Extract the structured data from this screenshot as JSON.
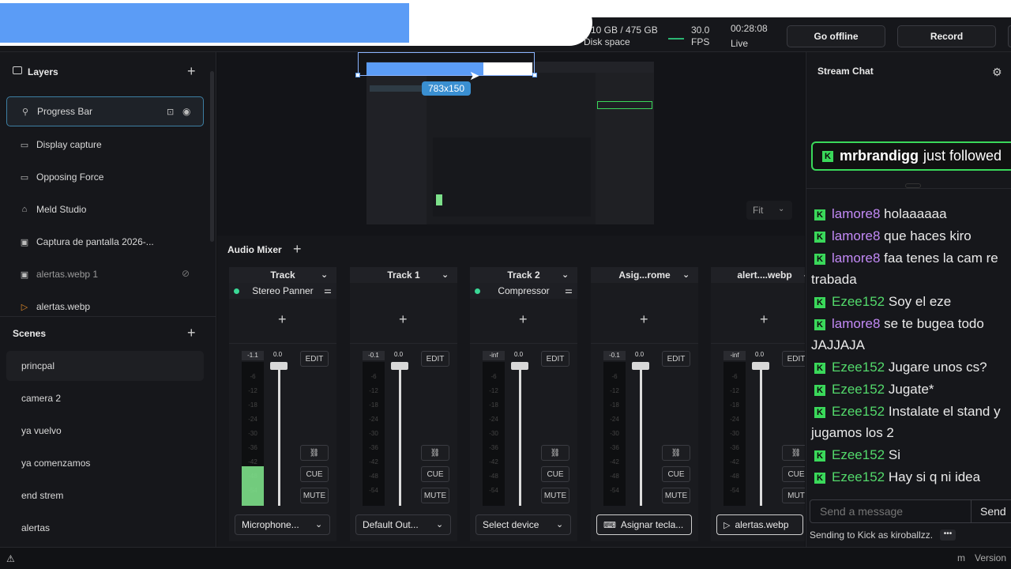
{
  "topbar": {
    "disk_value": "10 GB / 475 GB",
    "disk_label": "Disk space",
    "fps_value": "30.0",
    "fps_label": "FPS",
    "time_value": "00:28:08",
    "time_label": "Live",
    "go_offline": "Go offline",
    "record": "Record",
    "overlay_progress": 0.69
  },
  "layers": {
    "title": "Layers",
    "items": [
      {
        "label": "Progress Bar"
      },
      {
        "label": "Display capture"
      },
      {
        "label": "Opposing Force"
      },
      {
        "label": "Meld Studio"
      },
      {
        "label": "Captura de pantalla 2026-..."
      },
      {
        "label": "alertas.webp 1"
      },
      {
        "label": "alertas.webp"
      }
    ]
  },
  "scenes": {
    "title": "Scenes",
    "items": [
      {
        "label": "princpal"
      },
      {
        "label": "camera 2"
      },
      {
        "label": "ya vuelvo"
      },
      {
        "label": "ya comenzamos"
      },
      {
        "label": "end strem"
      },
      {
        "label": "alertas"
      }
    ]
  },
  "preview": {
    "size_badge": "783x150",
    "fit_label": "Fit"
  },
  "mixer": {
    "title": "Audio Mixer",
    "tracks": [
      {
        "name": "Track",
        "effect": "Stereo Panner",
        "level": "-1.1",
        "fader": "0.0",
        "device": "Microphone...",
        "edit": "EDIT",
        "cue": "CUE",
        "mute": "MUTE"
      },
      {
        "name": "Track 1",
        "effect": "",
        "level": "-0.1",
        "fader": "0.0",
        "device": "Default Out...",
        "edit": "EDIT",
        "cue": "CUE",
        "mute": "MUTE"
      },
      {
        "name": "Track 2",
        "effect": "Compressor",
        "level": "-inf",
        "fader": "0.0",
        "device": "Select device",
        "edit": "EDIT",
        "cue": "CUE",
        "mute": "MUTE"
      },
      {
        "name": "Asig...rome",
        "effect": "",
        "level": "-0.1",
        "fader": "0.0",
        "device": "Asignar tecla...",
        "edit": "EDIT",
        "cue": "CUE",
        "mute": "MUTE"
      },
      {
        "name": "alert....webp",
        "effect": "",
        "level": "-inf",
        "fader": "0.0",
        "device": "alertas.webp",
        "edit": "EDIT",
        "cue": "CUE",
        "mute": "MUT"
      }
    ],
    "scale": [
      "-6",
      "-12",
      "-18",
      "-24",
      "-30",
      "-36",
      "-42",
      "-48",
      "-54"
    ]
  },
  "chat": {
    "title": "Stream Chat",
    "follow_user": "mrbrandigg",
    "follow_text": "just followed",
    "messages": [
      {
        "user": "lamore8",
        "text": "holaaaaaa",
        "color": "#c38af7"
      },
      {
        "user": "lamore8",
        "text": "que haces kiro",
        "color": "#c38af7"
      },
      {
        "user": "lamore8",
        "text": "faa tenes la cam re trabada",
        "color": "#c38af7"
      },
      {
        "user": "Ezee152",
        "text": "Soy el eze",
        "color": "#53d96b"
      },
      {
        "user": "lamore8",
        "text": "se te bugea todo JAJJAJA",
        "color": "#c38af7"
      },
      {
        "user": "Ezee152",
        "text": "Jugare unos cs?",
        "color": "#53d96b"
      },
      {
        "user": "Ezee152",
        "text": "Jugate*",
        "color": "#53d96b"
      },
      {
        "user": "Ezee152",
        "text": "Instalate el stand y jugamos los 2",
        "color": "#53d96b"
      },
      {
        "user": "Ezee152",
        "text": "Si",
        "color": "#53d96b"
      },
      {
        "user": "Ezee152",
        "text": "Hay si q ni idea",
        "color": "#53d96b"
      }
    ],
    "input_placeholder": "Send a message",
    "send": "Send",
    "sending_as": "Sending to Kick as kiroballzz."
  },
  "bottombar": {
    "version": "Version"
  }
}
